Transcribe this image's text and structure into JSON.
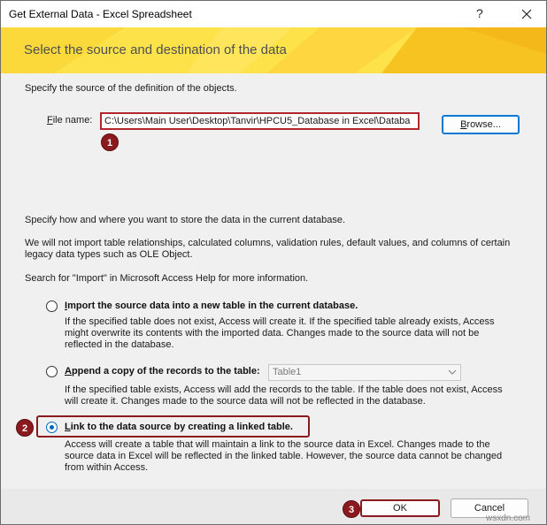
{
  "window": {
    "title": "Get External Data - Excel Spreadsheet",
    "help_label": "?",
    "close_icon": "close-icon"
  },
  "banner": {
    "heading": "Select the source and destination of the data"
  },
  "source": {
    "intro": "Specify the source of the definition of the objects.",
    "file_label_first": "F",
    "file_label_rest": "ile name:",
    "file_value": "C:\\Users\\Main User\\Desktop\\Tanvir\\HPCU5_Database in Excel\\Databa",
    "browse_first": "B",
    "browse_rest": "rowse..."
  },
  "store": {
    "intro": "Specify how and where you want to store the data in the current database.",
    "note": "We will not import table relationships, calculated columns, validation rules, default values, and columns of certain legacy data types such as OLE Object.",
    "help": "Search for \"Import\" in Microsoft Access Help for more information."
  },
  "options": [
    {
      "label_first": "I",
      "label_rest": "mport the source data into a new table in the current database.",
      "description": "If the specified table does not exist, Access will create it. If the specified table already exists, Access might overwrite its contents with the imported data. Changes made to the source data will not be reflected in the database.",
      "checked": false
    },
    {
      "label_first": "A",
      "label_rest": "ppend a copy of the records to the table:",
      "description": "If the specified table exists, Access will add the records to the table. If the table does not exist, Access will create it. Changes made to the source data will not be reflected in the database.",
      "select_value": "Table1",
      "checked": false
    },
    {
      "label_first": "L",
      "label_rest": "ink to the data source by creating a linked table.",
      "description": "Access will create a table that will maintain a link to the source data in Excel. Changes made to the source data in Excel will be reflected in the linked table. However, the source data cannot be changed from within Access.",
      "checked": true
    }
  ],
  "markers": [
    "1",
    "2",
    "3"
  ],
  "buttons": {
    "ok": "OK",
    "cancel": "Cancel"
  },
  "watermark": "wsxdn.com",
  "colors": {
    "banner": "#fde24a",
    "highlight": "#8b1a1f",
    "radio_selected": "#0067c0"
  }
}
